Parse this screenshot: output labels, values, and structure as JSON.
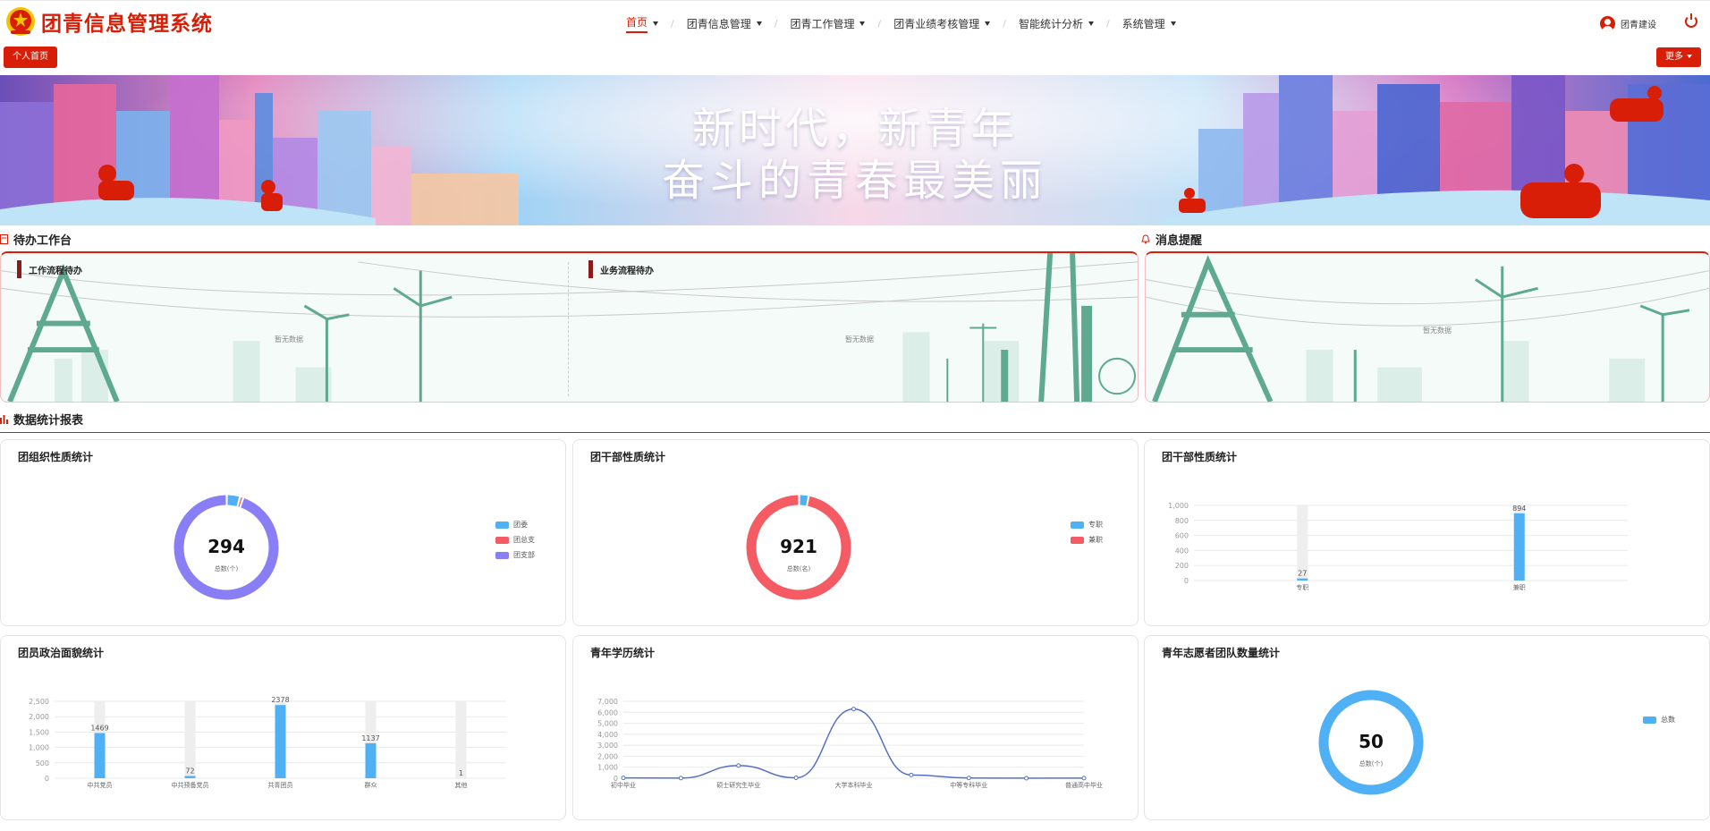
{
  "app": {
    "title": "团青信息管理系统"
  },
  "nav": {
    "items": [
      {
        "label": "首页",
        "active": true
      },
      {
        "label": "团青信息管理"
      },
      {
        "label": "团青工作管理"
      },
      {
        "label": "团青业绩考核管理"
      },
      {
        "label": "智能统计分析"
      },
      {
        "label": "系统管理"
      }
    ]
  },
  "user": {
    "name": "团青建设"
  },
  "tabs": {
    "home": "个人首页",
    "more": "更多"
  },
  "banner": {
    "line1": "新时代，新青年",
    "line2": "奋斗的青春最美丽"
  },
  "todo": {
    "title": "待办工作台",
    "work_flow": "工作流程待办",
    "biz_flow": "业务流程待办",
    "empty1": "暂无数据",
    "empty2": "暂无数据"
  },
  "notice": {
    "title": "消息提醒",
    "empty": "暂无数据"
  },
  "stats": {
    "title": "数据统计报表"
  },
  "colors": {
    "brand": "#d81e06",
    "blue": "#4fb0f5",
    "red": "#f45b62",
    "purple": "#8a7ef7",
    "teal": "#5fa991"
  },
  "chart_data": [
    {
      "id": "org",
      "type": "pie",
      "title": "团组织性质统计",
      "total": "294",
      "total_label": "总数(个)",
      "legend": [
        {
          "name": "团委",
          "color": "#4fb0f5",
          "value": 12
        },
        {
          "name": "团总支",
          "color": "#f45b62",
          "value": 3
        },
        {
          "name": "团支部",
          "color": "#8a7ef7",
          "value": 279
        }
      ]
    },
    {
      "id": "cadre",
      "type": "pie",
      "title": "团干部性质统计",
      "total": "921",
      "total_label": "总数(名)",
      "legend": [
        {
          "name": "专职",
          "color": "#4fb0f5",
          "value": 27
        },
        {
          "name": "兼职",
          "color": "#f45b62",
          "value": 894
        }
      ]
    },
    {
      "id": "cadre_bar",
      "type": "bar",
      "title": "团干部性质统计",
      "categories": [
        "专职",
        "兼职"
      ],
      "values": [
        27,
        894
      ],
      "ylim": [
        0,
        1000
      ],
      "yticks": [
        "0",
        "200",
        "400",
        "600",
        "800",
        "1,000"
      ]
    },
    {
      "id": "politics",
      "type": "bar",
      "title": "团员政治面貌统计",
      "categories": [
        "中共党员",
        "中共预备党员",
        "共青团员",
        "群众",
        "其他"
      ],
      "values": [
        1469,
        72,
        2378,
        1137,
        1
      ],
      "ylim": [
        0,
        2500
      ],
      "yticks": [
        "0",
        "500",
        "1,000",
        "1,500",
        "2,000",
        "2,500"
      ]
    },
    {
      "id": "edu",
      "type": "line",
      "title": "青年学历统计",
      "categories": [
        "初中毕业",
        "",
        "硕士研究生毕业",
        "",
        "大学本科毕业",
        "",
        "中等专科毕业",
        "",
        "普通高中毕业"
      ],
      "values": [
        30,
        10,
        1150,
        40,
        6300,
        300,
        20,
        5,
        10
      ],
      "ylim": [
        0,
        7000
      ],
      "yticks": [
        "0",
        "1,000",
        "2,000",
        "3,000",
        "4,000",
        "5,000",
        "6,000",
        "7,000"
      ]
    },
    {
      "id": "volunteer",
      "type": "pie",
      "title": "青年志愿者团队数量统计",
      "total": "50",
      "total_label": "总数(个)",
      "legend": [
        {
          "name": "总数",
          "color": "#4fb0f5",
          "value": 50
        }
      ]
    }
  ]
}
